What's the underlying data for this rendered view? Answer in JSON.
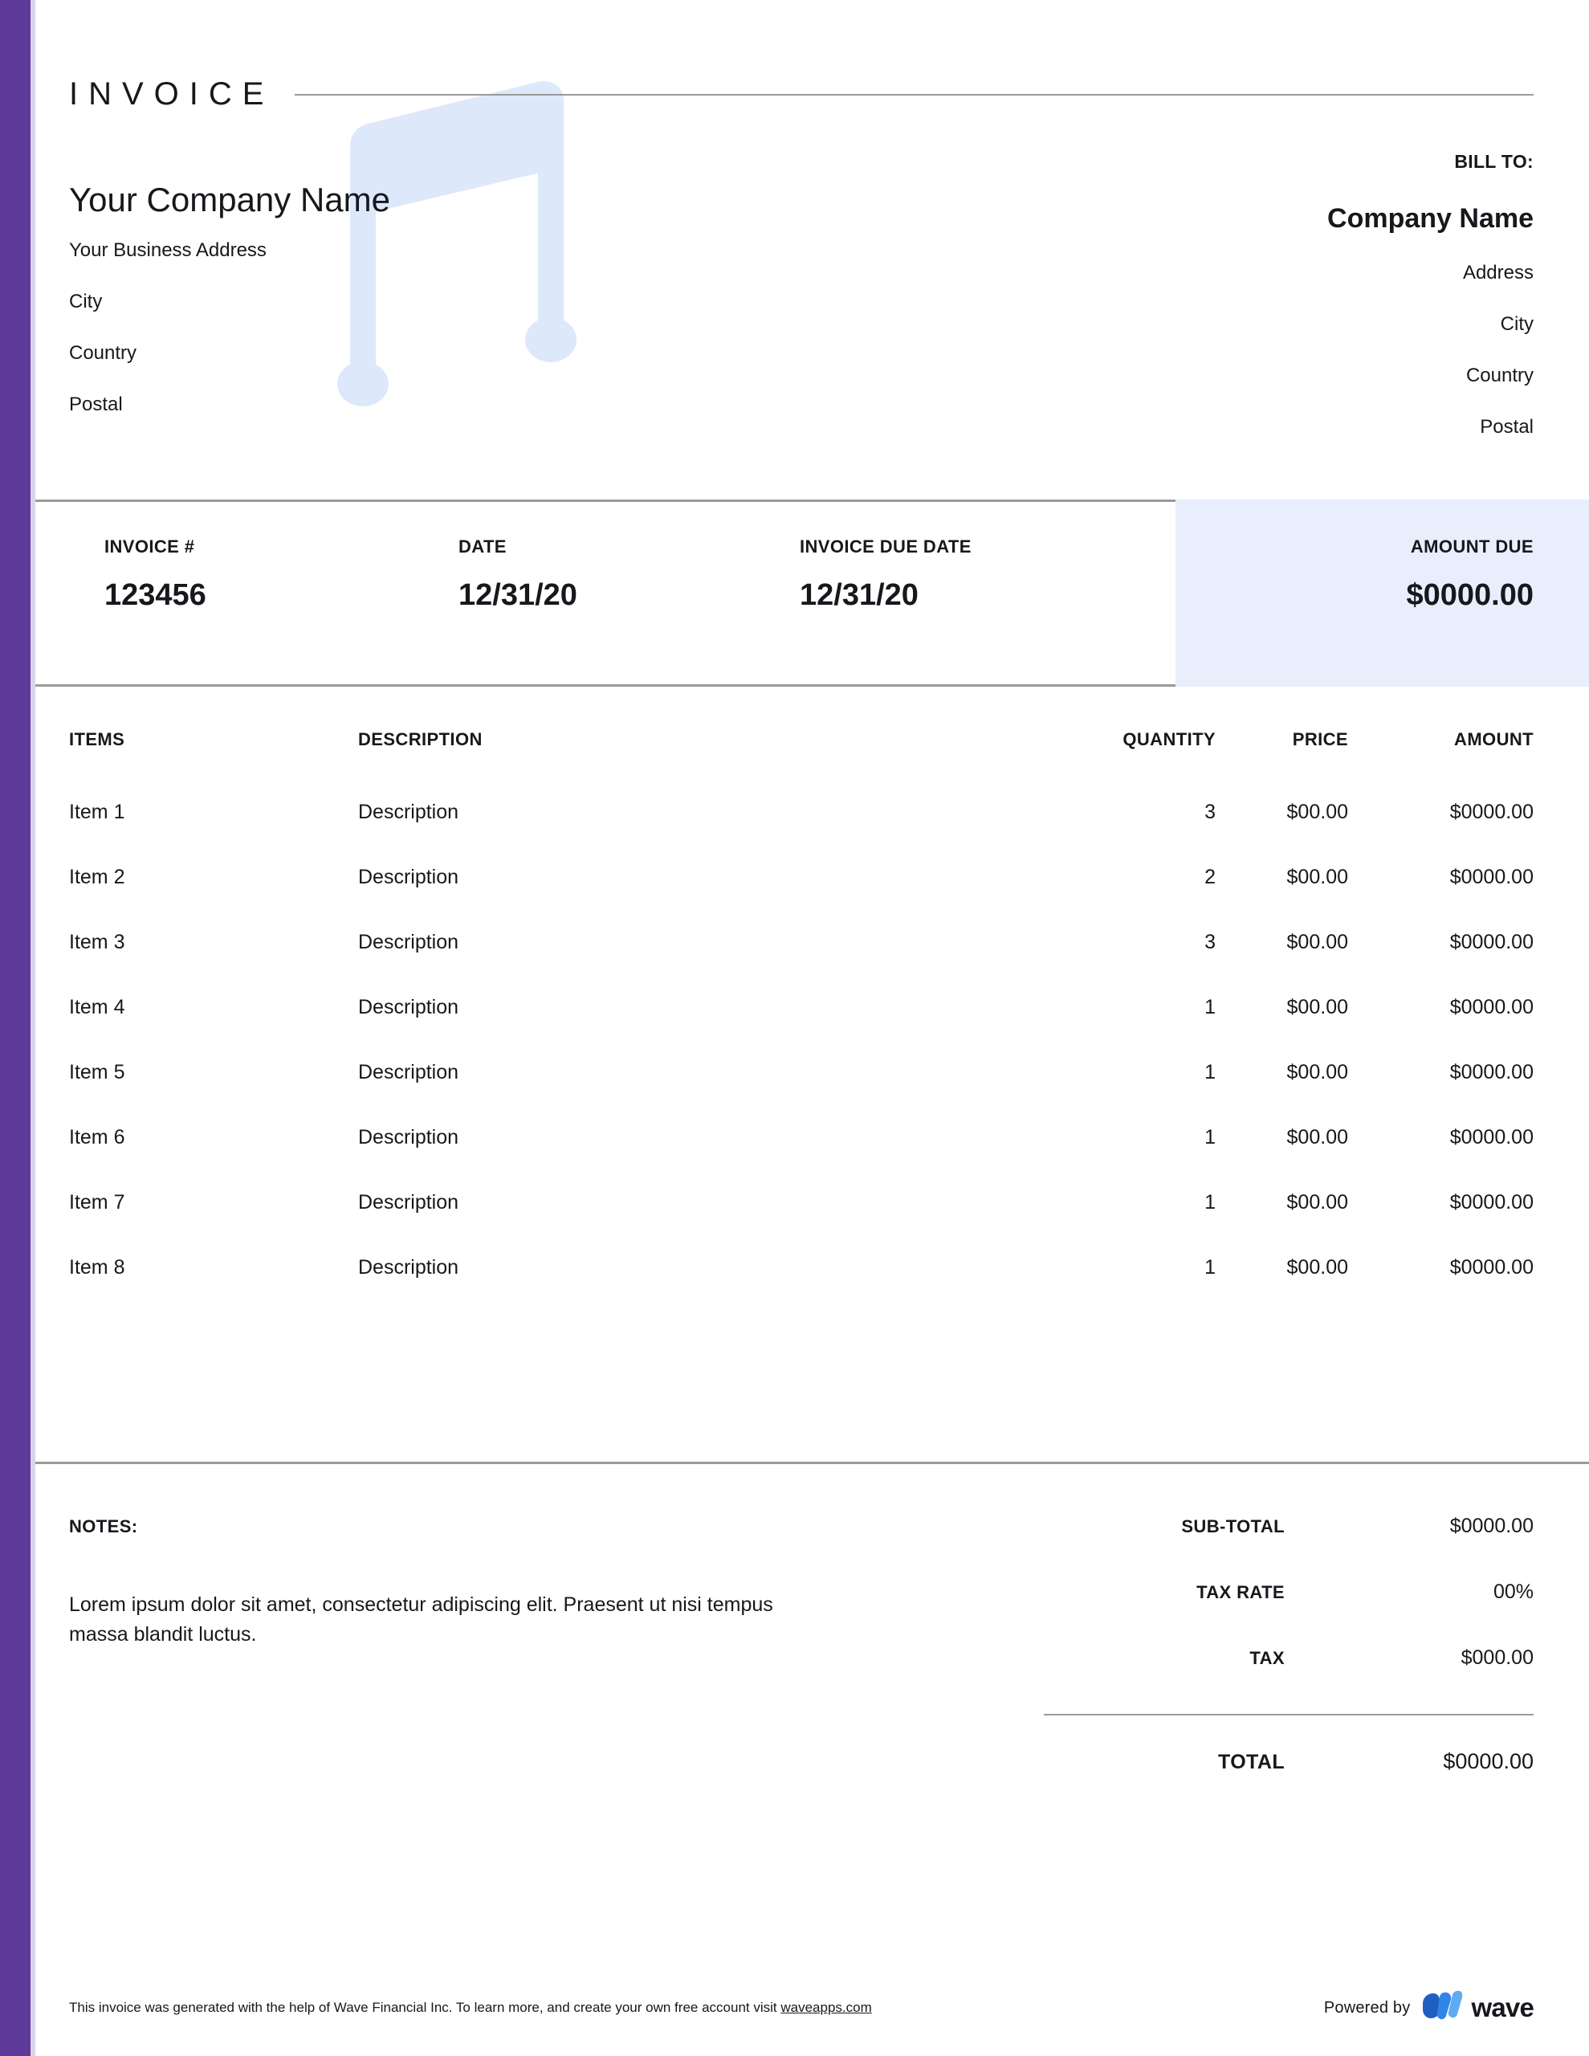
{
  "document": {
    "title": "INVOICE"
  },
  "seller": {
    "company_name": "Your Company Name",
    "address_lines": [
      "Your Business Address",
      "City",
      "Country",
      "Postal"
    ]
  },
  "bill_to": {
    "label": "BILL TO:",
    "company_name": "Company Name",
    "address_lines": [
      "Address",
      "City",
      "Country",
      "Postal"
    ]
  },
  "meta": {
    "invoice_number_label": "INVOICE #",
    "invoice_number": "123456",
    "date_label": "DATE",
    "date": "12/31/20",
    "due_date_label": "INVOICE DUE DATE",
    "due_date": "12/31/20",
    "amount_due_label": "AMOUNT DUE",
    "amount_due": "$0000.00"
  },
  "items_table": {
    "headers": {
      "items": "ITEMS",
      "description": "DESCRIPTION",
      "quantity": "QUANTITY",
      "price": "PRICE",
      "amount": "AMOUNT"
    },
    "rows": [
      {
        "item": "Item 1",
        "description": "Description",
        "quantity": "3",
        "price": "$00.00",
        "amount": "$0000.00"
      },
      {
        "item": "Item 2",
        "description": "Description",
        "quantity": "2",
        "price": "$00.00",
        "amount": "$0000.00"
      },
      {
        "item": "Item 3",
        "description": "Description",
        "quantity": "3",
        "price": "$00.00",
        "amount": "$0000.00"
      },
      {
        "item": "Item 4",
        "description": "Description",
        "quantity": "1",
        "price": "$00.00",
        "amount": "$0000.00"
      },
      {
        "item": "Item 5",
        "description": "Description",
        "quantity": "1",
        "price": "$00.00",
        "amount": "$0000.00"
      },
      {
        "item": "Item 6",
        "description": "Description",
        "quantity": "1",
        "price": "$00.00",
        "amount": "$0000.00"
      },
      {
        "item": "Item 7",
        "description": "Description",
        "quantity": "1",
        "price": "$00.00",
        "amount": "$0000.00"
      },
      {
        "item": "Item 8",
        "description": "Description",
        "quantity": "1",
        "price": "$00.00",
        "amount": "$0000.00"
      }
    ]
  },
  "notes": {
    "label": "NOTES:",
    "text": "Lorem ipsum dolor sit amet, consectetur adipiscing elit. Praesent ut nisi tempus massa blandit luctus."
  },
  "totals": {
    "subtotal_label": "SUB-TOTAL",
    "subtotal": "$0000.00",
    "tax_rate_label": "TAX RATE",
    "tax_rate": "00%",
    "tax_label": "TAX",
    "tax": "$000.00",
    "total_label": "TOTAL",
    "total": "$0000.00"
  },
  "footer": {
    "disclaimer_prefix": "This invoice was generated with the help of Wave Financial Inc. To learn more, and create your own free account visit ",
    "link_text": "waveapps.com",
    "powered_by_label": "Powered by",
    "brand_name": "wave"
  },
  "colors": {
    "spine_purple": "#5d3a99",
    "amount_due_panel": "#e8eefc",
    "watermark_blue": "#dde8fb",
    "rule_gray": "#9a9a9a",
    "wave_dark_blue": "#1e5fbf",
    "wave_mid_blue": "#2f86e8",
    "wave_light_blue": "#5eabf2"
  }
}
